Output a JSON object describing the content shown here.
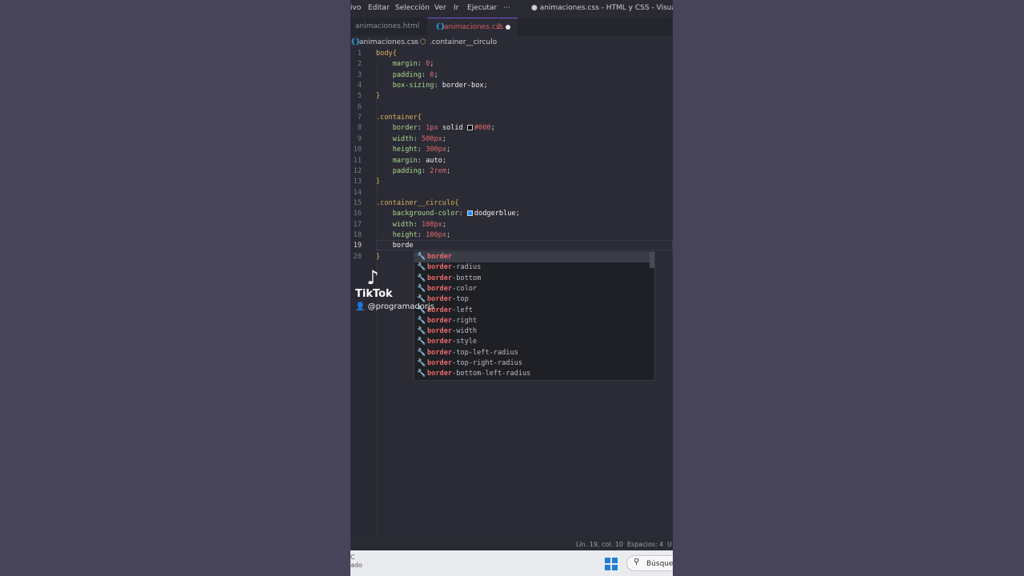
{
  "menubar": {
    "items": [
      "ivo",
      "Editar",
      "Selección",
      "Ver",
      "Ir",
      "Ejecutar",
      "···"
    ],
    "window_title": "● animaciones.css - HTML y CSS - Visual Studio"
  },
  "tabs": [
    {
      "label": "animaciones.html"
    },
    {
      "label": "animaciones.css",
      "problems": "2"
    }
  ],
  "breadcrumb": {
    "file": "animaciones.css",
    "separator": ">",
    "symbol": ".container__circulo"
  },
  "editor": {
    "lines": [
      {
        "n": "1",
        "tokens": [
          {
            "t": "body",
            "c": "sel"
          },
          {
            "t": "{",
            "c": "br"
          }
        ]
      },
      {
        "n": "2",
        "tokens": [
          {
            "t": "    margin",
            "c": "prop"
          },
          {
            "t": ": ",
            "c": "punc"
          },
          {
            "t": "0",
            "c": "num"
          },
          {
            "t": ";",
            "c": "punc"
          }
        ]
      },
      {
        "n": "3",
        "tokens": [
          {
            "t": "    padding",
            "c": "prop"
          },
          {
            "t": ": ",
            "c": "punc"
          },
          {
            "t": "0",
            "c": "num"
          },
          {
            "t": ";",
            "c": "punc"
          }
        ]
      },
      {
        "n": "4",
        "tokens": [
          {
            "t": "    box-sizing",
            "c": "prop"
          },
          {
            "t": ": ",
            "c": "punc"
          },
          {
            "t": "border-box",
            "c": "val"
          },
          {
            "t": ";",
            "c": "punc"
          }
        ]
      },
      {
        "n": "5",
        "tokens": [
          {
            "t": "}",
            "c": "br"
          }
        ]
      },
      {
        "n": "6",
        "tokens": []
      },
      {
        "n": "7",
        "tokens": [
          {
            "t": ".container",
            "c": "sel"
          },
          {
            "t": "{",
            "c": "br"
          }
        ]
      },
      {
        "n": "8",
        "tokens": [
          {
            "t": "    border",
            "c": "prop"
          },
          {
            "t": ": ",
            "c": "punc"
          },
          {
            "t": "1px",
            "c": "num"
          },
          {
            "t": " solid ",
            "c": "val"
          },
          {
            "t": "",
            "c": "swatch",
            "color": "#000000"
          },
          {
            "t": "#000",
            "c": "num"
          },
          {
            "t": ";",
            "c": "punc"
          }
        ]
      },
      {
        "n": "9",
        "tokens": [
          {
            "t": "    width",
            "c": "prop"
          },
          {
            "t": ": ",
            "c": "punc"
          },
          {
            "t": "500px",
            "c": "num"
          },
          {
            "t": ";",
            "c": "punc"
          }
        ]
      },
      {
        "n": "10",
        "tokens": [
          {
            "t": "    height",
            "c": "prop"
          },
          {
            "t": ": ",
            "c": "punc"
          },
          {
            "t": "300px",
            "c": "num"
          },
          {
            "t": ";",
            "c": "punc"
          }
        ]
      },
      {
        "n": "11",
        "tokens": [
          {
            "t": "    margin",
            "c": "prop"
          },
          {
            "t": ": ",
            "c": "punc"
          },
          {
            "t": "auto",
            "c": "val"
          },
          {
            "t": ";",
            "c": "punc"
          }
        ]
      },
      {
        "n": "12",
        "tokens": [
          {
            "t": "    padding",
            "c": "prop"
          },
          {
            "t": ": ",
            "c": "punc"
          },
          {
            "t": "2rem",
            "c": "num"
          },
          {
            "t": ";",
            "c": "punc"
          }
        ]
      },
      {
        "n": "13",
        "tokens": [
          {
            "t": "}",
            "c": "br"
          }
        ]
      },
      {
        "n": "14",
        "tokens": []
      },
      {
        "n": "15",
        "tokens": [
          {
            "t": ".container__circulo",
            "c": "sel"
          },
          {
            "t": "{",
            "c": "br"
          }
        ]
      },
      {
        "n": "16",
        "tokens": [
          {
            "t": "    background-color",
            "c": "prop"
          },
          {
            "t": ": ",
            "c": "punc"
          },
          {
            "t": "",
            "c": "swatch",
            "color": "#1e90ff"
          },
          {
            "t": "dodgerblue",
            "c": "val"
          },
          {
            "t": ";",
            "c": "punc"
          }
        ]
      },
      {
        "n": "17",
        "tokens": [
          {
            "t": "    width",
            "c": "prop"
          },
          {
            "t": ": ",
            "c": "punc"
          },
          {
            "t": "100px",
            "c": "num"
          },
          {
            "t": ";",
            "c": "punc"
          }
        ]
      },
      {
        "n": "18",
        "tokens": [
          {
            "t": "    height",
            "c": "prop"
          },
          {
            "t": ": ",
            "c": "punc"
          },
          {
            "t": "100px",
            "c": "num"
          },
          {
            "t": ";",
            "c": "punc"
          }
        ]
      },
      {
        "n": "19",
        "tokens": [
          {
            "t": "    borde",
            "c": "val"
          }
        ]
      },
      {
        "n": "20",
        "tokens": [
          {
            "t": "}",
            "c": "br"
          }
        ]
      }
    ],
    "active_line": "19"
  },
  "suggestions": {
    "match": "border",
    "items": [
      "border",
      "border-radius",
      "border-bottom",
      "border-color",
      "border-top",
      "border-left",
      "border-right",
      "border-width",
      "border-style",
      "border-top-left-radius",
      "border-top-right-radius",
      "border-bottom-left-radius"
    ]
  },
  "overlay": {
    "brand": "TikTok",
    "user": "@programadorjs"
  },
  "statusbar": {
    "position": "Lín. 19, col. 10",
    "spaces": "Espacios: 4",
    "encoding": "U"
  },
  "taskbar": {
    "left_line1": "C",
    "left_line2": "ado",
    "search_placeholder": "Búsque"
  },
  "colors": {
    "accent": "#7a52d6",
    "match": "#e96a6a",
    "windows": "#1f7fd6"
  }
}
